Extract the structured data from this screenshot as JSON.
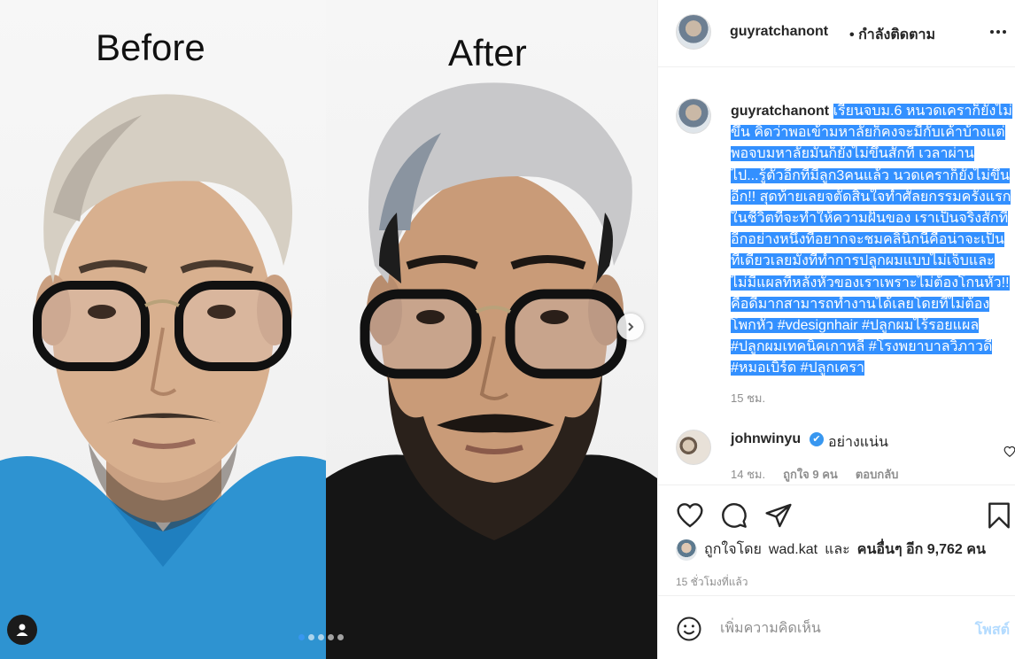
{
  "photo": {
    "before_label": "Before",
    "after_label": "After",
    "slide_count": 5,
    "active_slide": 1
  },
  "header": {
    "username": "guyratchanont",
    "separator": "•",
    "follow_status": "กำลังติดตาม"
  },
  "caption": {
    "username": "guyratchanont",
    "text": "เรียนจบม.6 หนวดเคราก็ยังไม่ขึ้น คิดว่าพอเข้ามหาลัยก็คงจะมีกับเค้าบ้างแต่พอจบมหาลัยมันก็ยังไม่ขึ้นสักที เวลาผ่านไป...รู้ตัวอีกทีมีลูก3คนแล้ว นวดเคราก็ยังไม่ขึ้นอีก!! สุดท้ายเลยจตัดสินใจทำศัลยกรรมครั้งแรกในชีวิตที่จะทำให้ความฝันของ เราเป็นจริงสักที อีกอย่างหนึ่งที่อยากจะชมคลินิกนี้คือน่าจะเป็นที่เดียวเลยมั้งที่ทำการปลูกผมแบบไม่เจ็บและไม่มีแผลที่หลังหัวของเราเพราะไม่ต้องโกนหัว!! คือดีมากสามารถทำงานได้เลยโดยที่ไม่ต้องโพกหัว #vdesignhair #ปลูกผมไร้รอยแผล #ปลูกผมเทคนิคเกาหลี #โรงพยาบาลวิภาวดี #หมอเบิร์ด #ปลูกเครา",
    "time": "15 ชม."
  },
  "reply": {
    "username": "johnwinyu",
    "verified_mark": "✔",
    "text": "อย่างแน่น",
    "time": "14 ชม.",
    "likes": "ถูกใจ 9 คน",
    "reply_label": "ตอบกลับ"
  },
  "likes": {
    "prefix": "ถูกใจโดย",
    "first_user": "wad.kat",
    "and": "และ",
    "others": "คนอื่นๆ อีก 9,762 คน"
  },
  "post_time": "15 ชั่วโมงที่แล้ว",
  "comment_box": {
    "placeholder": "เพิ่มความคิดเห็น",
    "post_label": "โพสต์"
  }
}
